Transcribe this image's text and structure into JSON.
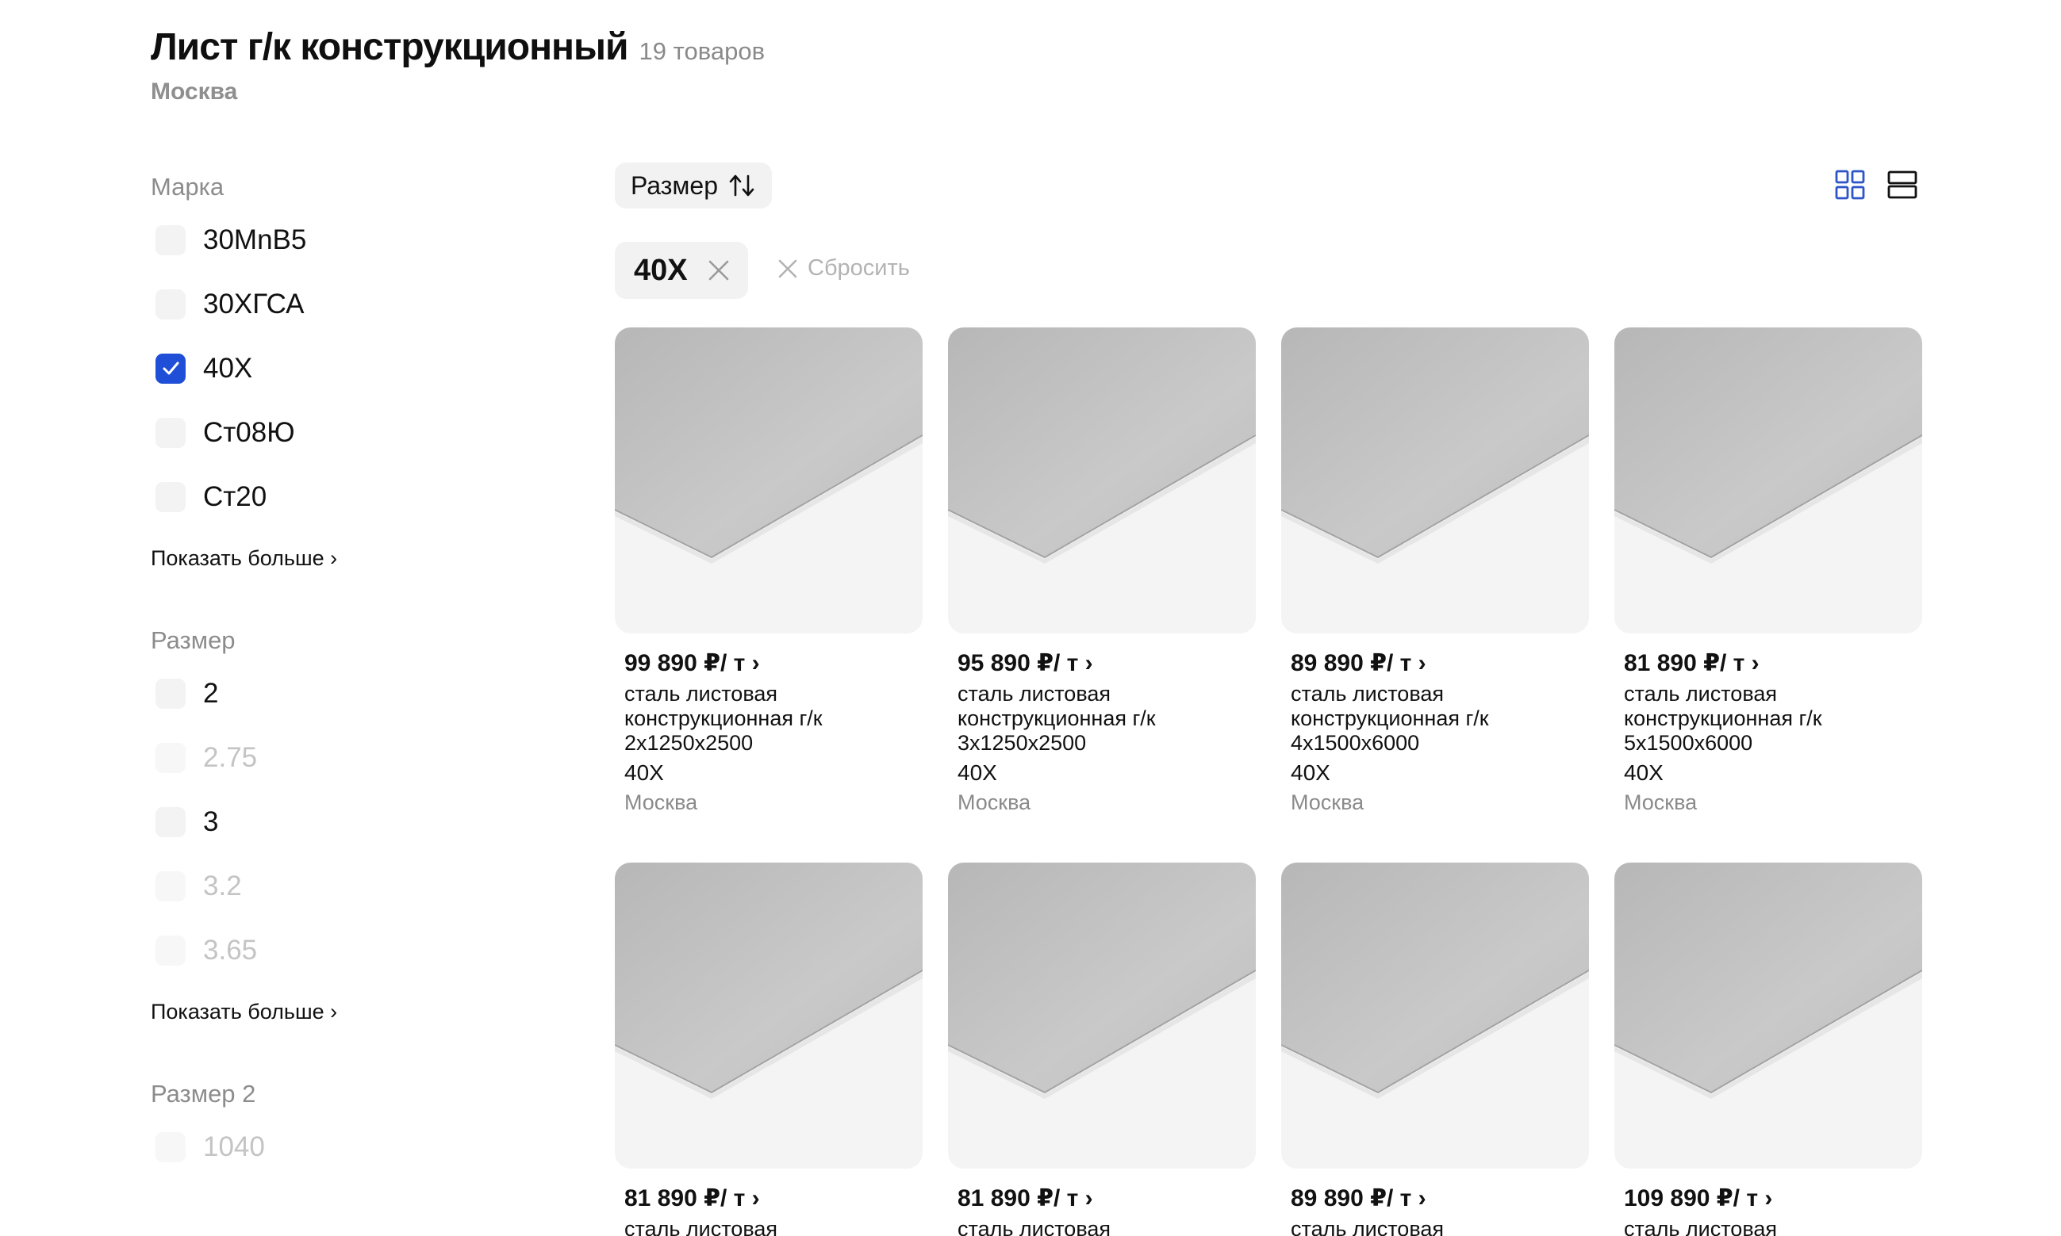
{
  "header": {
    "title": "Лист г/к конструкционный",
    "count": "19 товаров",
    "city": "Москва"
  },
  "filters": [
    {
      "title": "Марка",
      "options": [
        {
          "label": "30MnB5",
          "checked": false,
          "disabled": false
        },
        {
          "label": "30ХГСА",
          "checked": false,
          "disabled": false
        },
        {
          "label": "40Х",
          "checked": true,
          "disabled": false
        },
        {
          "label": "Ст08Ю",
          "checked": false,
          "disabled": false
        },
        {
          "label": "Ст20",
          "checked": false,
          "disabled": false
        }
      ],
      "show_more": "Показать больше ›"
    },
    {
      "title": "Размер",
      "options": [
        {
          "label": "2",
          "checked": false,
          "disabled": false
        },
        {
          "label": "2.75",
          "checked": false,
          "disabled": true
        },
        {
          "label": "3",
          "checked": false,
          "disabled": false
        },
        {
          "label": "3.2",
          "checked": false,
          "disabled": true
        },
        {
          "label": "3.65",
          "checked": false,
          "disabled": true
        }
      ],
      "show_more": "Показать больше ›"
    },
    {
      "title": "Размер 2",
      "options": [
        {
          "label": "1040",
          "checked": false,
          "disabled": true
        }
      ]
    }
  ],
  "toolbar": {
    "sort_label": "Размер",
    "sort_icon": "sort-arrows-icon",
    "grid_view_icon": "grid-view-icon",
    "list_view_icon": "list-view-icon",
    "active_view_color": "#2d55c8"
  },
  "active_filters": {
    "chips": [
      {
        "label": "40Х"
      }
    ],
    "reset_label": "Сбросить"
  },
  "products": [
    {
      "price": "99 890 ₽/ т ›",
      "name": "сталь листовая конструкционная г/к 2x1250x2500",
      "grade": "40Х",
      "city": "Москва"
    },
    {
      "price": "95 890 ₽/ т ›",
      "name": "сталь листовая конструкционная г/к 3x1250x2500",
      "grade": "40Х",
      "city": "Москва"
    },
    {
      "price": "89 890 ₽/ т ›",
      "name": "сталь листовая конструкционная г/к 4x1500x6000",
      "grade": "40Х",
      "city": "Москва"
    },
    {
      "price": "81 890 ₽/ т ›",
      "name": "сталь листовая конструкционная г/к 5x1500x6000",
      "grade": "40Х",
      "city": "Москва"
    },
    {
      "price": "81 890 ₽/ т ›",
      "name": "сталь листовая",
      "grade": "",
      "city": ""
    },
    {
      "price": "81 890 ₽/ т ›",
      "name": "сталь листовая",
      "grade": "",
      "city": ""
    },
    {
      "price": "89 890 ₽/ т ›",
      "name": "сталь листовая",
      "grade": "",
      "city": ""
    },
    {
      "price": "109 890 ₽/ т ›",
      "name": "сталь листовая",
      "grade": "",
      "city": ""
    }
  ],
  "colors": {
    "accent": "#1f4fd6",
    "muted_text": "#8a8a8a",
    "chip_bg": "#f2f2f2"
  }
}
